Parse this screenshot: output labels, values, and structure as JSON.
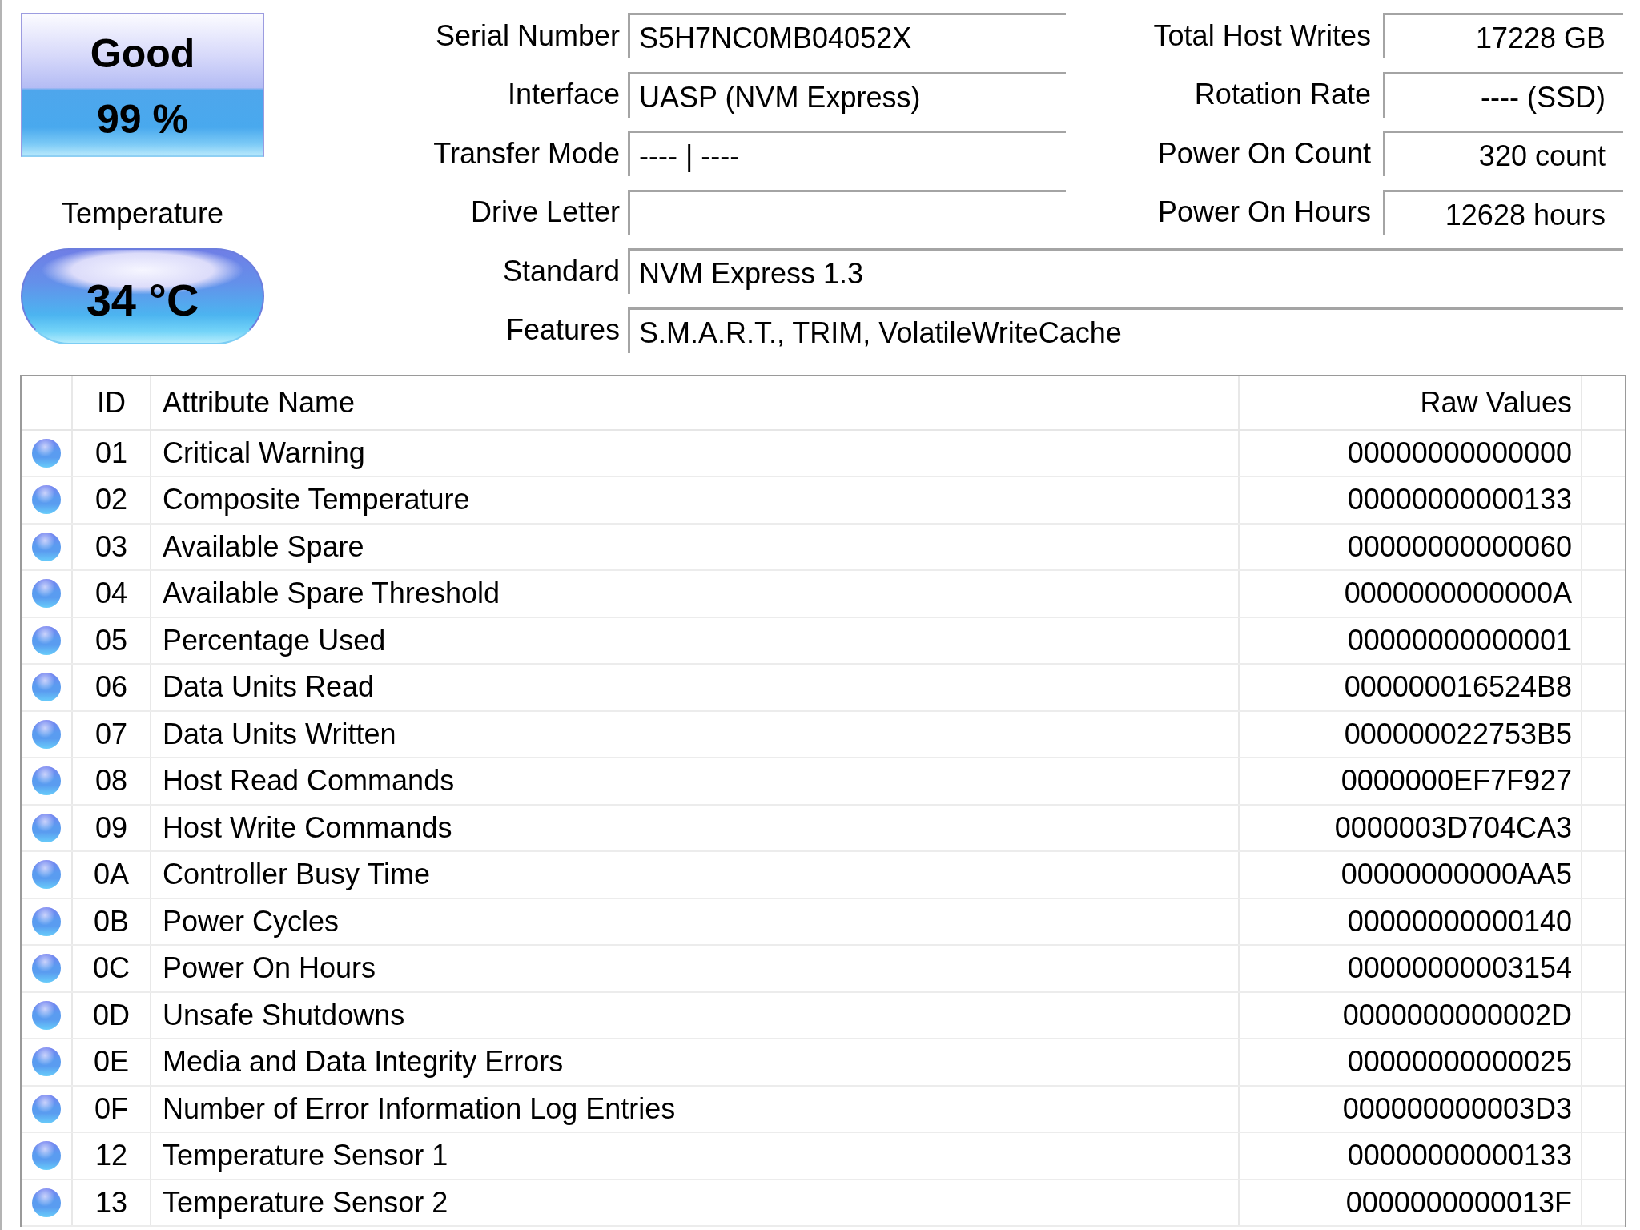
{
  "health": {
    "status": "Good",
    "percent": "99 %"
  },
  "temperature": {
    "label": "Temperature",
    "value": "34 °C"
  },
  "info_left": [
    {
      "label": "Serial Number",
      "value": "S5H7NC0MB04052X"
    },
    {
      "label": "Interface",
      "value": "UASP (NVM Express)"
    },
    {
      "label": "Transfer Mode",
      "value": "---- | ----"
    },
    {
      "label": "Drive Letter"
    }
  ],
  "info_right": [
    {
      "label": "Total Host Writes",
      "value": "17228 GB"
    },
    {
      "label": "Rotation Rate",
      "value": "---- (SSD)"
    },
    {
      "label": "Power On Count",
      "value": "320 count"
    },
    {
      "label": "Power On Hours",
      "value": "12628 hours"
    }
  ],
  "info_wide": [
    {
      "label": "Standard",
      "value": "NVM Express 1.3"
    },
    {
      "label": "Features",
      "value": "S.M.A.R.T., TRIM, VolatileWriteCache"
    }
  ],
  "smart_table": {
    "columns": [
      "ID",
      "Attribute Name",
      "Raw Values"
    ],
    "rows": [
      {
        "color": "#5a9cf0",
        "id": "01",
        "name": "Critical Warning",
        "raw": "00000000000000"
      },
      {
        "color": "#5a9cf0",
        "id": "02",
        "name": "Composite Temperature",
        "raw": "00000000000133"
      },
      {
        "color": "#5a9cf0",
        "id": "03",
        "name": "Available Spare",
        "raw": "00000000000060"
      },
      {
        "color": "#5a9cf0",
        "id": "04",
        "name": "Available Spare Threshold",
        "raw": "0000000000000A"
      },
      {
        "color": "#5a9cf0",
        "id": "05",
        "name": "Percentage Used",
        "raw": "00000000000001"
      },
      {
        "color": "#5a9cf0",
        "id": "06",
        "name": "Data Units Read",
        "raw": "000000016524B8"
      },
      {
        "color": "#5a9cf0",
        "id": "07",
        "name": "Data Units Written",
        "raw": "000000022753B5"
      },
      {
        "color": "#5a9cf0",
        "id": "08",
        "name": "Host Read Commands",
        "raw": "0000000EF7F927"
      },
      {
        "color": "#5a9cf0",
        "id": "09",
        "name": "Host Write Commands",
        "raw": "0000003D704CA3"
      },
      {
        "color": "#5a9cf0",
        "id": "0A",
        "name": "Controller Busy Time",
        "raw": "00000000000AA5"
      },
      {
        "color": "#5a9cf0",
        "id": "0B",
        "name": "Power Cycles",
        "raw": "00000000000140"
      },
      {
        "color": "#5a9cf0",
        "id": "0C",
        "name": "Power On Hours",
        "raw": "00000000003154"
      },
      {
        "color": "#5a9cf0",
        "id": "0D",
        "name": "Unsafe Shutdowns",
        "raw": "0000000000002D"
      },
      {
        "color": "#5a9cf0",
        "id": "0E",
        "name": "Media and Data Integrity Errors",
        "raw": "00000000000025"
      },
      {
        "color": "#5a9cf0",
        "id": "0F",
        "name": "Number of Error Information Log Entries",
        "raw": "000000000003D3"
      },
      {
        "color": "#5a9cf0",
        "id": "12",
        "name": "Temperature Sensor 1",
        "raw": "00000000000133"
      },
      {
        "color": "#5a9cf0",
        "id": "13",
        "name": "Temperature Sensor 2",
        "raw": "0000000000013F"
      }
    ]
  }
}
